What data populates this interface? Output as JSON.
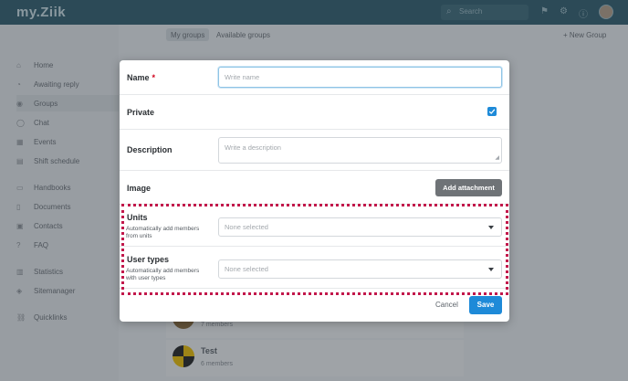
{
  "app": {
    "logo": "my.Ziik"
  },
  "topbar": {
    "search_placeholder": "Search",
    "icons": [
      "flag-icon",
      "gear-icon",
      "help-icon"
    ]
  },
  "sidebar": {
    "items": [
      {
        "label": "Home",
        "icon": "⌂"
      },
      {
        "label": "Awaiting reply",
        "icon": "◔"
      },
      {
        "label": "Groups",
        "icon": "◉"
      },
      {
        "label": "Chat",
        "icon": "◯"
      },
      {
        "label": "Events",
        "icon": "▦"
      },
      {
        "label": "Shift schedule",
        "icon": "▤"
      },
      {
        "label": "Handbooks",
        "icon": "▭"
      },
      {
        "label": "Documents",
        "icon": "▯"
      },
      {
        "label": "Contacts",
        "icon": "▣"
      },
      {
        "label": "FAQ",
        "icon": "?"
      },
      {
        "label": "Statistics",
        "icon": "▥"
      },
      {
        "label": "Sitemanager",
        "icon": "◈"
      },
      {
        "label": "Quicklinks",
        "icon": "⛓"
      }
    ]
  },
  "tabs": [
    {
      "label": "My groups"
    },
    {
      "label": "Available groups"
    }
  ],
  "new_group_label": "+ New Group",
  "groups": [
    {
      "name": "",
      "members": "7 members"
    },
    {
      "name": "Test",
      "members": "6 members"
    }
  ],
  "modal": {
    "name": {
      "label": "Name",
      "required": "*",
      "placeholder": "Write name"
    },
    "private": {
      "label": "Private",
      "checked": true
    },
    "description": {
      "label": "Description",
      "placeholder": "Write a description"
    },
    "image": {
      "label": "Image",
      "button": "Add attachment"
    },
    "units": {
      "label": "Units",
      "help": "Automatically add members from units",
      "value": "None selected"
    },
    "user_types": {
      "label": "User types",
      "help": "Automatically add members with user types",
      "value": "None selected"
    },
    "cancel_label": "Cancel",
    "save_label": "Save"
  },
  "colors": {
    "primary": "#1e8ad8",
    "topbar": "#2f5e6e",
    "highlight": "#c2184b"
  }
}
